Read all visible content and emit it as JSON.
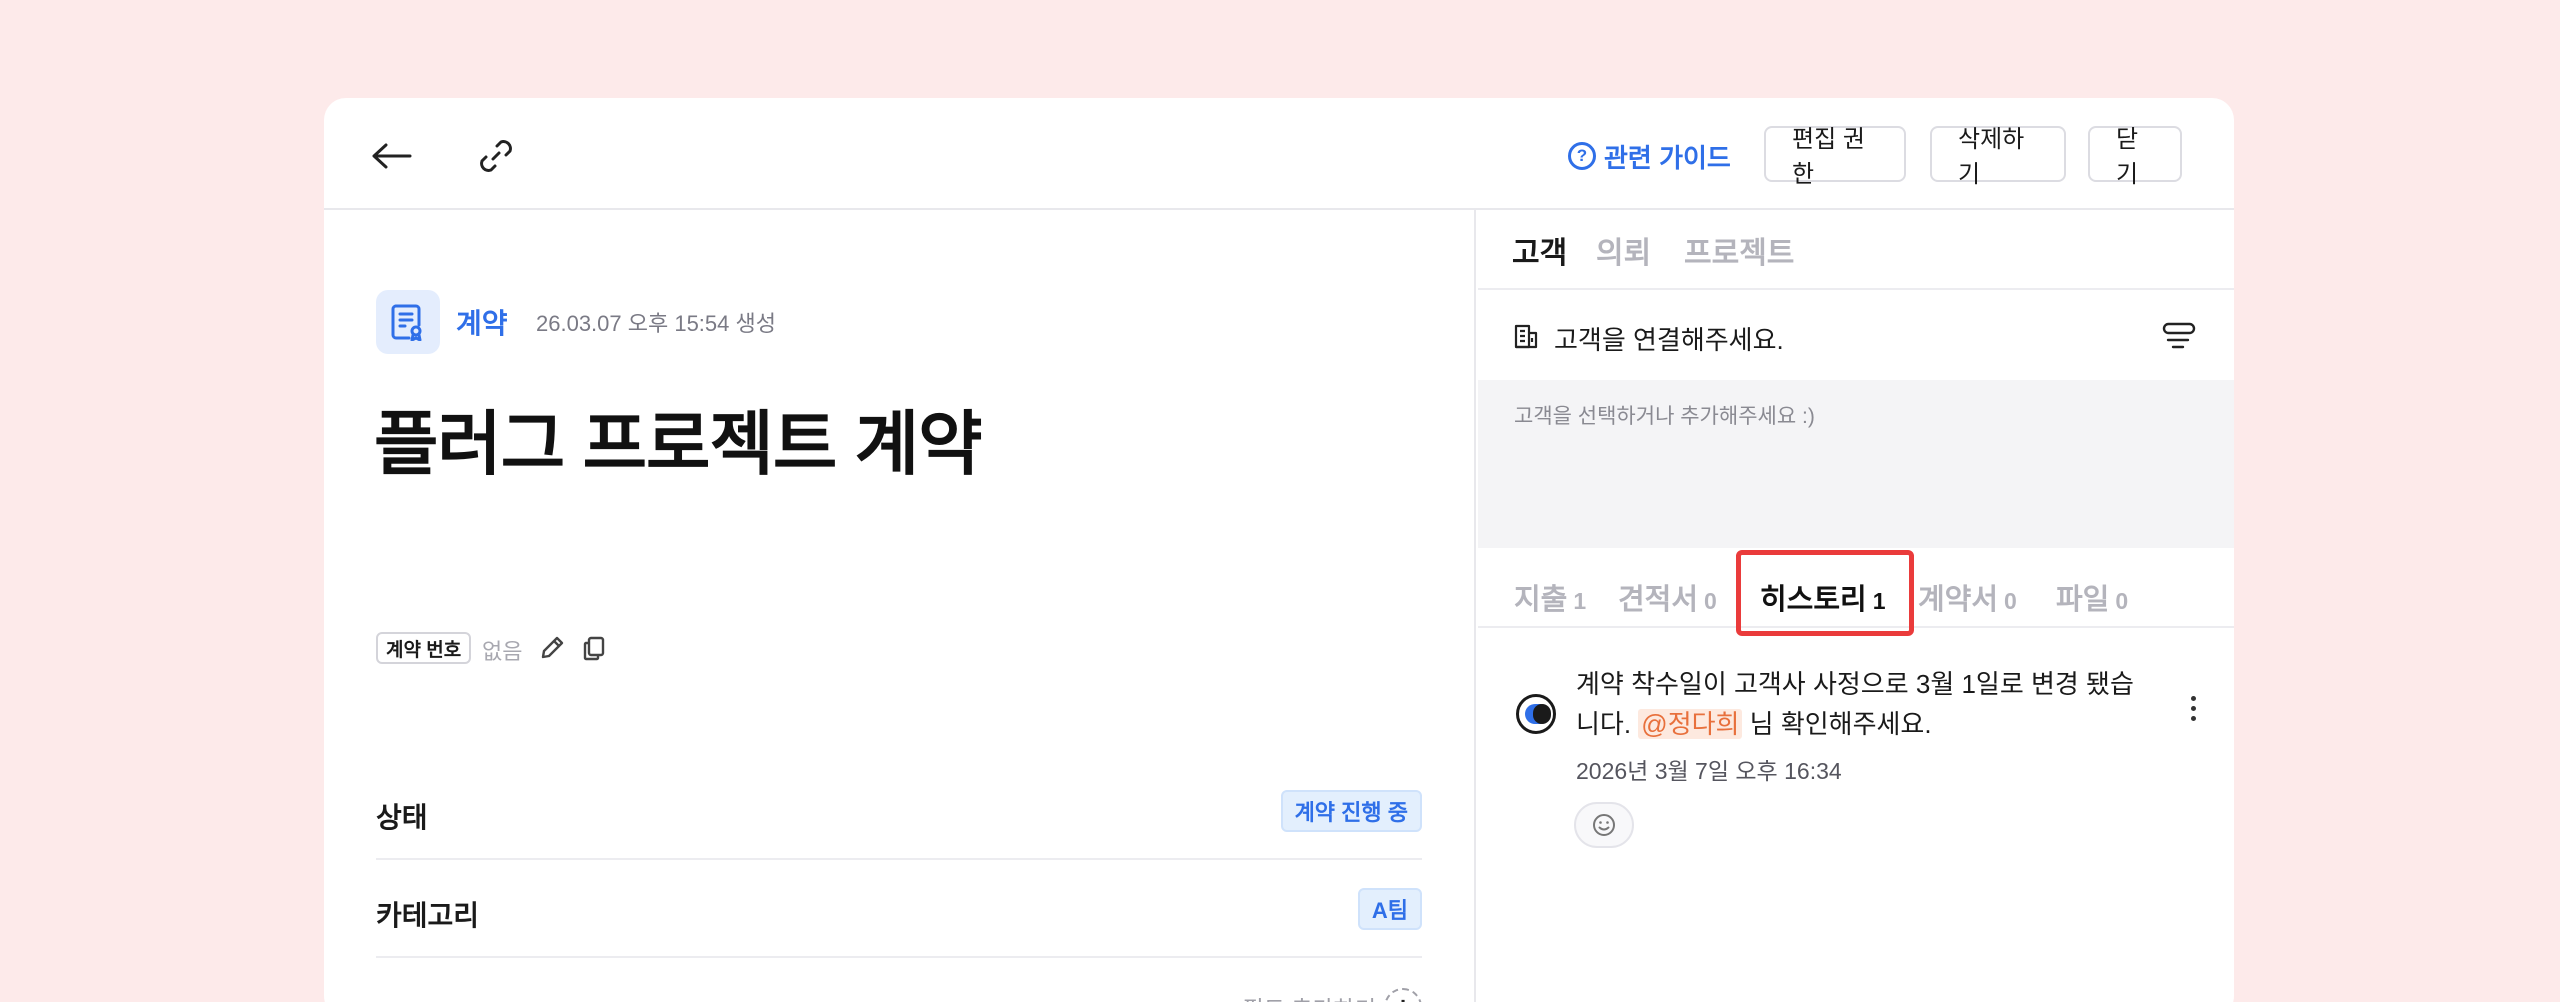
{
  "toolbar": {
    "guide_label": "관련 가이드",
    "edit_permission_label": "편집 권한",
    "delete_label": "삭제하기",
    "close_label": "닫기"
  },
  "record": {
    "type_label": "계약",
    "created": "26.03.07 오후 15:54 생성",
    "title": "플러그 프로젝트 계약",
    "contract_number_label": "계약 번호",
    "contract_number_value": "없음"
  },
  "fields": [
    {
      "label": "상태",
      "value": "계약 진행 중"
    },
    {
      "label": "카테고리",
      "value": "A팀"
    }
  ],
  "add_field_label": "필드 추가하기",
  "top_tabs": [
    "고객",
    "의뢰",
    "프로젝트"
  ],
  "customer": {
    "connect_label": "고객을 연결해주세요.",
    "placeholder": "고객을 선택하거나 추가해주세요 :)"
  },
  "sub_tabs": [
    {
      "label": "지출",
      "count": "1"
    },
    {
      "label": "견적서",
      "count": "0"
    },
    {
      "label": "히스토리",
      "count": "1"
    },
    {
      "label": "계약서",
      "count": "0"
    },
    {
      "label": "파일",
      "count": "0"
    }
  ],
  "history": {
    "message_part1": "계약 착수일이 고객사 사정으로 3월 1일로 변경 됐습니다. ",
    "mention": "@정다희",
    "message_part2": " 님 확인해주세요.",
    "timestamp": "2026년 3월 7일 오후 16:34"
  },
  "colors": {
    "accent": "#2f6fe8",
    "highlight_border": "#ea3b3b",
    "mention": "#e8703c",
    "background": "#fdeaea"
  }
}
